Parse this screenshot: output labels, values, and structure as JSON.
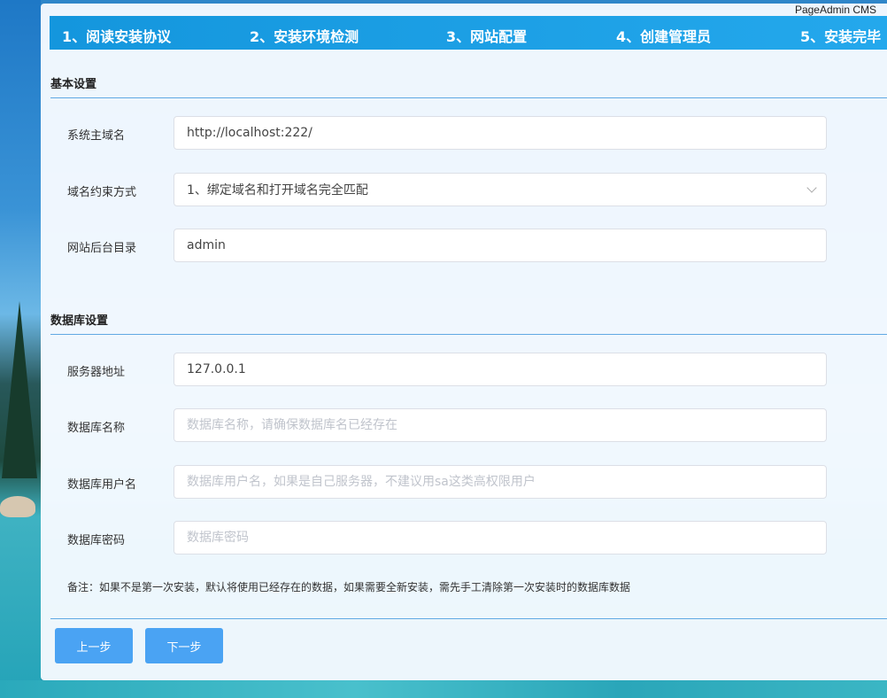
{
  "brand": "PageAdmin CMS",
  "steps": [
    "1、阅读安装协议",
    "2、安装环境检测",
    "3、网站配置",
    "4、创建管理员",
    "5、安装完毕"
  ],
  "basic": {
    "title": "基本设置",
    "domain_label": "系统主域名",
    "domain_value": "http://localhost:222/",
    "constraint_label": "域名约束方式",
    "constraint_value": "1、绑定域名和打开域名完全匹配",
    "admin_dir_label": "网站后台目录",
    "admin_dir_value": "admin"
  },
  "database": {
    "title": "数据库设置",
    "server_label": "服务器地址",
    "server_value": "127.0.0.1",
    "dbname_label": "数据库名称",
    "dbname_placeholder": "数据库名称，请确保数据库名已经存在",
    "user_label": "数据库用户名",
    "user_placeholder": "数据库用户名，如果是自己服务器，不建议用sa这类高权限用户",
    "password_label": "数据库密码",
    "password_placeholder": "数据库密码"
  },
  "note": "备注：如果不是第一次安装，默认将使用已经存在的数据，如果需要全新安装，需先手工清除第一次安装时的数据库数据",
  "buttons": {
    "prev": "上一步",
    "next": "下一步"
  }
}
